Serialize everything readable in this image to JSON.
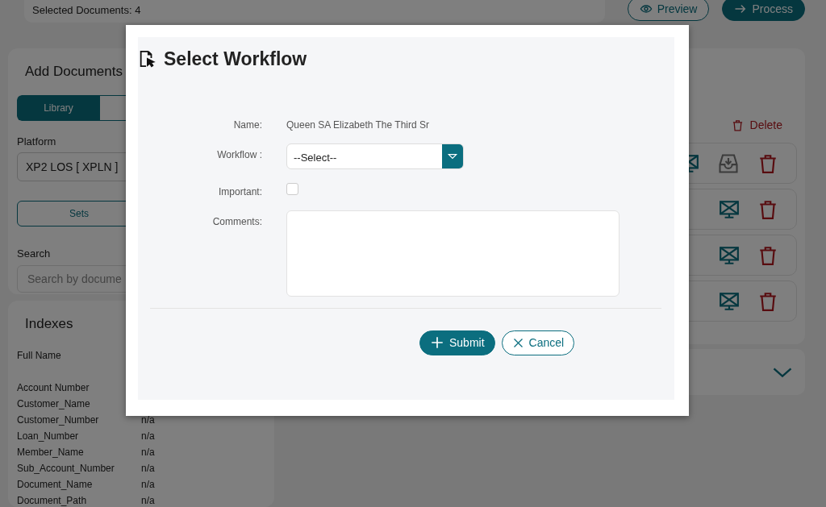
{
  "top_bar": {
    "selected_label": "Selected Documents: 4",
    "buttons": [
      {
        "label": "Preview",
        "kind": "outline"
      },
      {
        "label": "Process",
        "kind": "solid"
      }
    ]
  },
  "add_documents": {
    "title": "Add Documents",
    "tabs": [
      {
        "label": "Library",
        "selected": true
      },
      {
        "selected": false
      }
    ],
    "platform": {
      "label": "Platform",
      "value": "XP2 LOS [ XPLN ]"
    },
    "sets_button": "Sets",
    "search": {
      "label": "Search",
      "placeholder": "Search by docume"
    }
  },
  "indexes": {
    "title": "Indexes",
    "rows": [
      {
        "name": "Full Name"
      },
      {
        "name": "Account Number"
      },
      {
        "name": "Customer_Name"
      },
      {
        "name": "Customer_Number",
        "value": "n/a"
      },
      {
        "name": "Loan_Number",
        "value": "n/a"
      },
      {
        "name": "Member_Name",
        "value": "n/a"
      },
      {
        "name": "Sub_Account_Number",
        "value": "n/a"
      },
      {
        "name": "Document_Name",
        "value": "n/a"
      },
      {
        "name": "Document_Path",
        "value": "n/a"
      }
    ]
  },
  "documents": {
    "delete_label": "Delete",
    "rows": [
      {
        "downloadable": true
      },
      {
        "downloadable": false
      },
      {
        "downloadable": false
      },
      {
        "downloadable": false
      }
    ]
  },
  "collapsed_panel": {
    "expanded": false
  },
  "dialog": {
    "title": "Select Workflow",
    "fields": [
      {
        "kind": "text",
        "label": "Name:",
        "value": "Queen SA Elizabeth The Third Sr"
      },
      {
        "kind": "select",
        "label": "Workflow :",
        "value": "--Select--"
      },
      {
        "kind": "checkbox",
        "label": "Important:",
        "checked": false
      },
      {
        "kind": "textarea",
        "label": "Comments:"
      }
    ],
    "buttons": [
      {
        "label": "Submit",
        "kind": "primary"
      },
      {
        "label": "Cancel",
        "kind": "outline"
      }
    ]
  }
}
